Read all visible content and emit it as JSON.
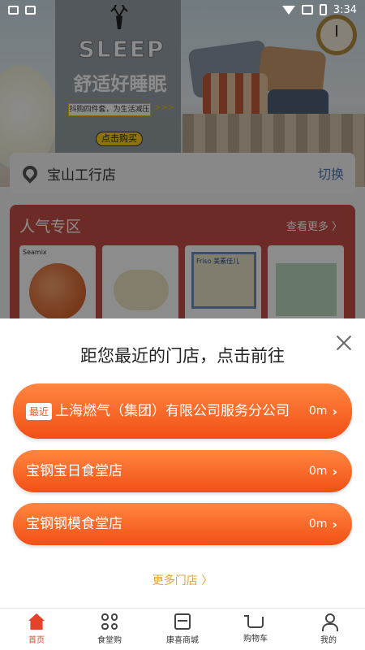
{
  "status_bar": {
    "time": "3:34"
  },
  "banner": {
    "headline": "SLEEP",
    "tagline": "舒适好睡眠",
    "subtitle": "抖购四件套，为生活减压",
    "arrows": ">>>",
    "buy_label": "点击购买"
  },
  "store_bar": {
    "store_name": "宝山工行店",
    "switch_label": "切换"
  },
  "popular": {
    "title": "人气专区",
    "more_label": "查看更多 〉",
    "products": [
      {
        "label": "Seamix"
      },
      {
        "label": ""
      },
      {
        "label": "Friso 美素佳儿"
      },
      {
        "label": ""
      }
    ]
  },
  "sheet": {
    "title": "距您最近的门店，点击前往",
    "options": [
      {
        "badge": "最近",
        "name": "上海燃气（集团）有限公司服务分公司",
        "distance": "0m"
      },
      {
        "name": "宝钢宝日食堂店",
        "distance": "0m"
      },
      {
        "name": "宝钢钢模食堂店",
        "distance": "0m"
      }
    ],
    "more_label": "更多门店 〉"
  },
  "bottom_nav": {
    "items": [
      {
        "label": "首页",
        "icon": "home-icon",
        "active": true
      },
      {
        "label": "食堂购",
        "icon": "grid-icon"
      },
      {
        "label": "康喜商城",
        "icon": "store-icon"
      },
      {
        "label": "购物车",
        "icon": "cart-icon"
      },
      {
        "label": "我的",
        "icon": "user-icon"
      }
    ]
  },
  "colors": {
    "accent": "#f24f16",
    "nav_active": "#e8412b",
    "popular_bg": "#c64f47",
    "link": "#4d78b8",
    "more_link": "#e8a13a"
  }
}
